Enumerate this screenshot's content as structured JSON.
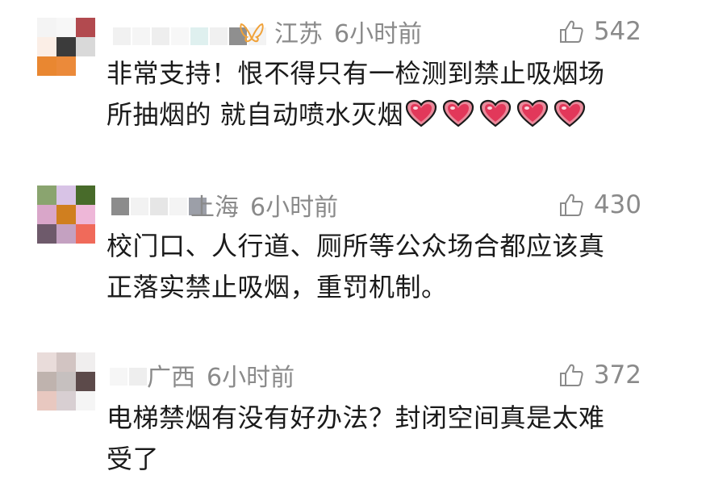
{
  "comments": [
    {
      "location": "江苏",
      "time": "6小时前",
      "likes": "542",
      "badge_icon": "butterfly-badge-icon",
      "line1": "非常支持！恨不得只有一检测到禁止吸烟场",
      "line2": "所抽烟的 就自动喷水灭烟",
      "hearts": 5,
      "avatar_colors": [
        "#f4f4f4",
        "#f7f7f7",
        "#b24a4f",
        "#fbeee6",
        "#3b3b3b",
        "#d9d9d9",
        "#e98731",
        "#eb8a3a",
        "#ffffff"
      ]
    },
    {
      "location": "上海",
      "time": "6小时前",
      "likes": "430",
      "line1": "校门口、人行道、厕所等公众场合都应该真",
      "line2": "正落实禁止吸烟，重罚机制。",
      "avatar_colors": [
        "#8aa46f",
        "#d8c3e6",
        "#486b2a",
        "#d9a6c9",
        "#d07f1f",
        "#eeb7d8",
        "#6e5a6b",
        "#c4a1c1",
        "#f06a5a"
      ]
    },
    {
      "location": "广西",
      "time": "6小时前",
      "likes": "372",
      "line1": "电梯禁烟有没有好办法？封闭空间真是太难",
      "line2": "受了",
      "avatar_colors": [
        "#e9dcda",
        "#d2c4c2",
        "#f0eeee",
        "#bfb3ae",
        "#c6c0bf",
        "#5c4a4a",
        "#e8c8c0",
        "#d8cfd2",
        "#f5f5f5"
      ]
    }
  ]
}
